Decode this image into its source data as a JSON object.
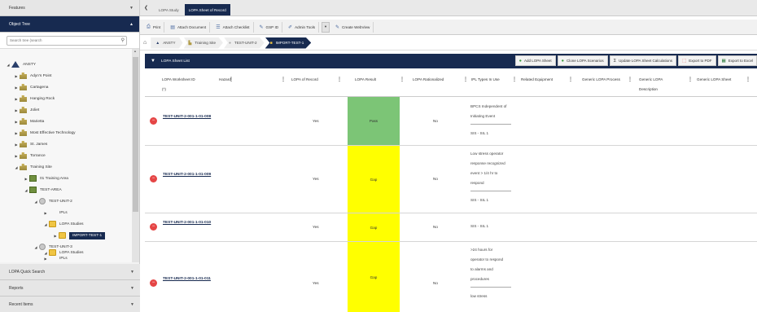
{
  "left_panel": {
    "features_label": "Features",
    "object_tree_label": "Object Tree",
    "search_placeholder": "Search tree (search",
    "tree": [
      {
        "label": "ANSTY",
        "icon": "site-root-icon"
      },
      {
        "label": "Adyn's Point",
        "icon": "building-icon"
      },
      {
        "label": "Cartagena",
        "icon": "building-icon"
      },
      {
        "label": "Hanging Rock",
        "icon": "building-icon"
      },
      {
        "label": "Joliet",
        "icon": "building-icon"
      },
      {
        "label": "Marietta",
        "icon": "building-icon"
      },
      {
        "label": "Most Effective Technology",
        "icon": "building-icon"
      },
      {
        "label": "St. James",
        "icon": "building-icon"
      },
      {
        "label": "Torrance",
        "icon": "building-icon"
      },
      {
        "label": "Training Site",
        "icon": "building-icon"
      },
      {
        "label": "01 Training Area",
        "icon": "area-icon"
      },
      {
        "label": "TEST-AREA",
        "icon": "area-icon"
      },
      {
        "label": "TEST-UNIT-2",
        "icon": "unit-icon"
      },
      {
        "label": "IPLs",
        "icon": "ipl-icon"
      },
      {
        "label": "LOPA Studies",
        "icon": "folder-icon"
      },
      {
        "label": "IMPORT-TEST-1",
        "icon": "folder-icon"
      },
      {
        "label": "TEST-UNIT-3",
        "icon": "unit-icon"
      },
      {
        "label": "IPLs",
        "icon": "ipl-icon"
      },
      {
        "label": "LOPA Studies",
        "icon": "folder-icon"
      }
    ],
    "quick_search_label": "LOPA Quick Search",
    "reports_label": "Reports",
    "recent_items_label": "Recent Items"
  },
  "tabs": [
    {
      "label": "LOPA Study"
    },
    {
      "label": "LOPA Sheet of Record"
    }
  ],
  "toolbar": {
    "print": "Print",
    "attach_document": "Attach Document",
    "attach_checklist": "Attach Checklist",
    "gsp_id": "GSP ID",
    "admin_tools": "Admin Tools",
    "create_webview": "Create WebView"
  },
  "breadcrumb": [
    "ANSTY",
    "Training Site",
    "TEST-UNIT-2",
    "IMPORT-TEST-1"
  ],
  "grid": {
    "title": "LOPA Sheet List",
    "actions": {
      "add": "Add LOPA Sheet",
      "clone": "Clone LOPA Scenarios",
      "update": "Update LOPA Sheet Calculations",
      "pdf": "Export to PDF",
      "excel": "Export to Excel"
    },
    "columns": {
      "worksheet_id": "LOPA Worksheet ID",
      "required_mark": "(*)",
      "hazard": "Hazard",
      "of_record": "LOPA of Record",
      "result": "LOPA Result",
      "rationalized": "LOPA Rationalized",
      "ipl_types": "IPL Types In Use",
      "related_equipment": "Related Equipment",
      "generic_process": "Generic LOPA Process",
      "generic_description": "Generic LOPA Description",
      "generic_sheet": "Generic LOPA Sheet"
    },
    "rows": [
      {
        "id": "TEST-UNIT-2-001-1-01-008",
        "of_record": "Yes",
        "result": "Pass",
        "result_color": "#7cc576",
        "rationalized": "No",
        "ipl": [
          "BPCS Independent of",
          "Initiating Event",
          "SIS - SIL 1"
        ]
      },
      {
        "id": "TEST-UNIT-2-001-1-01-009",
        "of_record": "Yes",
        "result": "Gap",
        "result_color": "#ffff00",
        "rationalized": "No",
        "ipl": [
          "Low stress operator",
          "response recognized",
          "event > 1/4 hr to",
          "respond",
          "SIS - SIL 1"
        ]
      },
      {
        "id": "TEST-UNIT-2-001-1-01-010",
        "of_record": "Yes",
        "result": "Gap",
        "result_color": "#ffff00",
        "rationalized": "No",
        "ipl": [
          "SIS - SIL 1"
        ]
      },
      {
        "id": "TEST-UNIT-2-001-1-01-011",
        "of_record": "Yes",
        "result": "Gap",
        "result_color": "#ffff00",
        "rationalized": "No",
        "ipl": [
          ">24 hours for",
          "operator to respond",
          "to alarms and",
          "procedures",
          "low stress"
        ]
      }
    ]
  },
  "colors": {
    "navy": "#172a50",
    "pass": "#7cc576",
    "gap": "#ffff00",
    "delete": "#e54545"
  }
}
